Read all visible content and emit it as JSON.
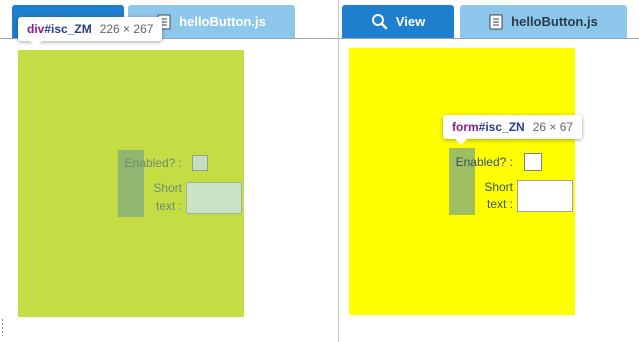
{
  "left_pane": {
    "tabs": [
      {
        "label": ""
      },
      {
        "label": "helloButton.js"
      }
    ],
    "tooltip": {
      "tag": "div",
      "id": "#isc_ZM",
      "size": "226 × 267"
    },
    "form": {
      "enabled_label": "Enabled? :",
      "short_label_1": "Short",
      "short_label_2": "text :"
    },
    "colors": {
      "canvas": "#c5dd45"
    }
  },
  "right_pane": {
    "tabs": [
      {
        "label": "View"
      },
      {
        "label": "helloButton.js"
      }
    ],
    "tooltip": {
      "tag": "form",
      "id": "#isc_ZN",
      "size": "26 × 67"
    },
    "form": {
      "enabled_label": "Enabled? :",
      "short_label_1": "Short",
      "short_label_2": "text :"
    },
    "colors": {
      "canvas": "#ffff00"
    }
  },
  "colors": {
    "tab_active": "#1e7fce",
    "tab_inactive": "#8ec7ec"
  },
  "icons": [
    "search-icon",
    "file-icon"
  ]
}
